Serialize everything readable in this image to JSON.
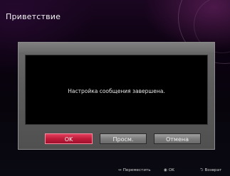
{
  "window": {
    "title": "Приветствие"
  },
  "dialog": {
    "message": "Настройка сообщения завершена.",
    "buttons": {
      "ok_label": "OK",
      "view_label": "Просм.",
      "cancel_label": "Отмена"
    }
  },
  "hint_bar": {
    "move": {
      "icon": "left-right-arrows-icon",
      "glyph": "↔",
      "label": "Переместить"
    },
    "ok": {
      "icon": "ok-button-icon",
      "glyph": "◉",
      "label": "OK"
    },
    "back": {
      "icon": "return-arrow-icon",
      "glyph": "⮌",
      "label": "Возврат"
    }
  },
  "colors": {
    "accent_selected": "#c01c3a",
    "button_default": "#7e7e7e",
    "panel": "#5c5c5c",
    "message_bg": "#000000"
  }
}
